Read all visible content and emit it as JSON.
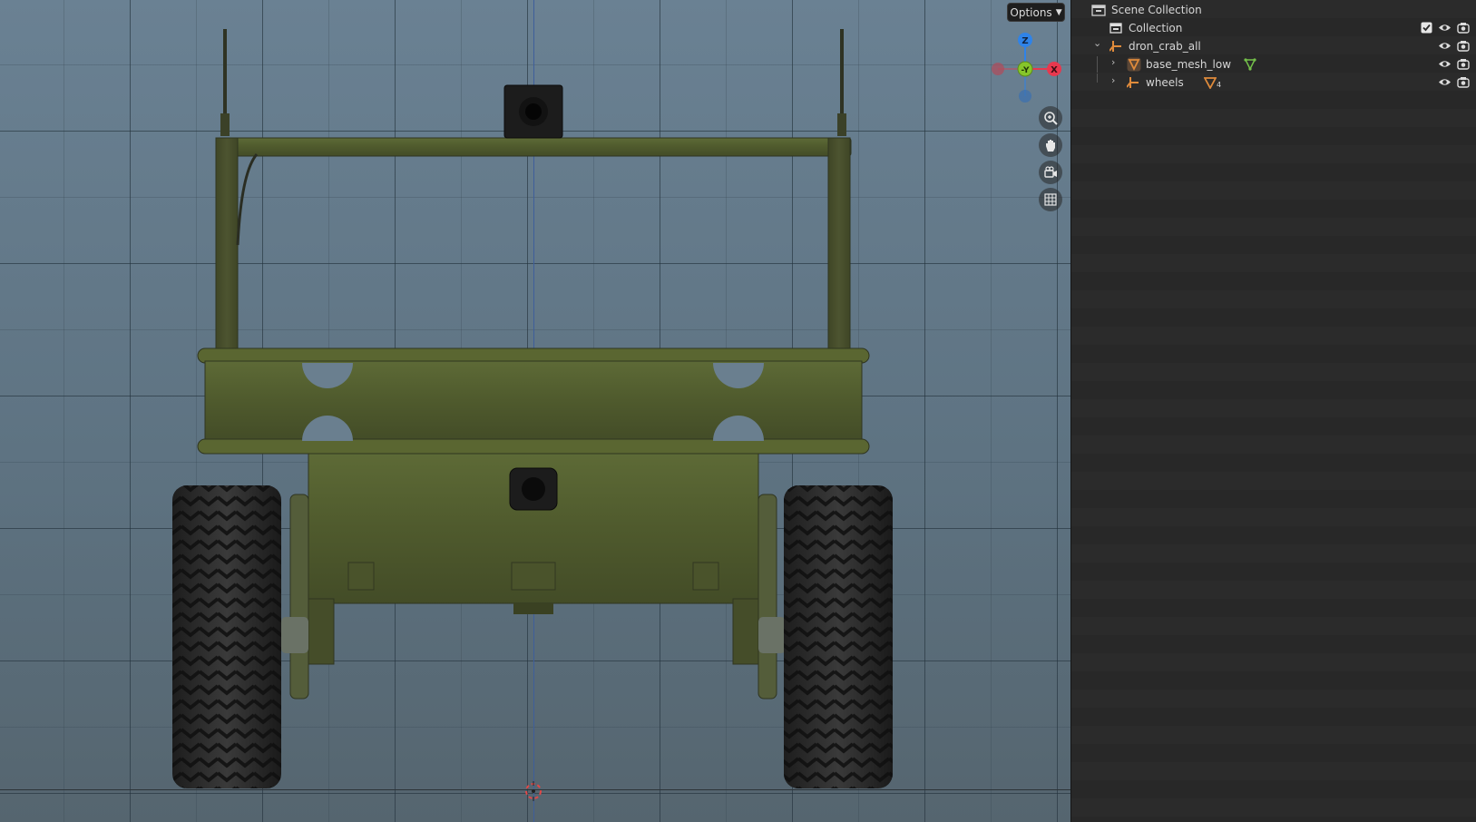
{
  "viewport": {
    "options_label": "Options",
    "gizmo_axes": {
      "z": "Z",
      "y": "-Y",
      "x": "X"
    },
    "gizmo_colors": {
      "z": "#2f83e8",
      "y": "#86c52a",
      "x": "#e8384e"
    },
    "nav_icons": [
      "zoom-icon",
      "hand-pan-icon",
      "camera-view-icon",
      "grid-ortho-icon"
    ]
  },
  "outliner": {
    "rows": [
      {
        "label": "Scene Collection",
        "icon": "scene-collection-icon",
        "indent": 0
      },
      {
        "label": "Collection",
        "icon": "collection-icon",
        "indent": 1,
        "checked": true
      },
      {
        "label": "dron_crab_all",
        "icon": "empty-object-icon",
        "indent": 1,
        "expanded": true
      },
      {
        "label": "base_mesh_low",
        "icon": "mesh-object-icon",
        "indent": 2,
        "expanded": false,
        "extra_icon": "vertex-group-icon"
      },
      {
        "label": "wheels",
        "icon": "empty-object-icon",
        "indent": 2,
        "expanded": false,
        "extra_icon": "mesh-data-icon",
        "extra_count": "4"
      }
    ],
    "colors": {
      "mesh_orange": "#e08b3b",
      "vertex_green": "#74c04a",
      "text": "#d6d6d6"
    }
  }
}
